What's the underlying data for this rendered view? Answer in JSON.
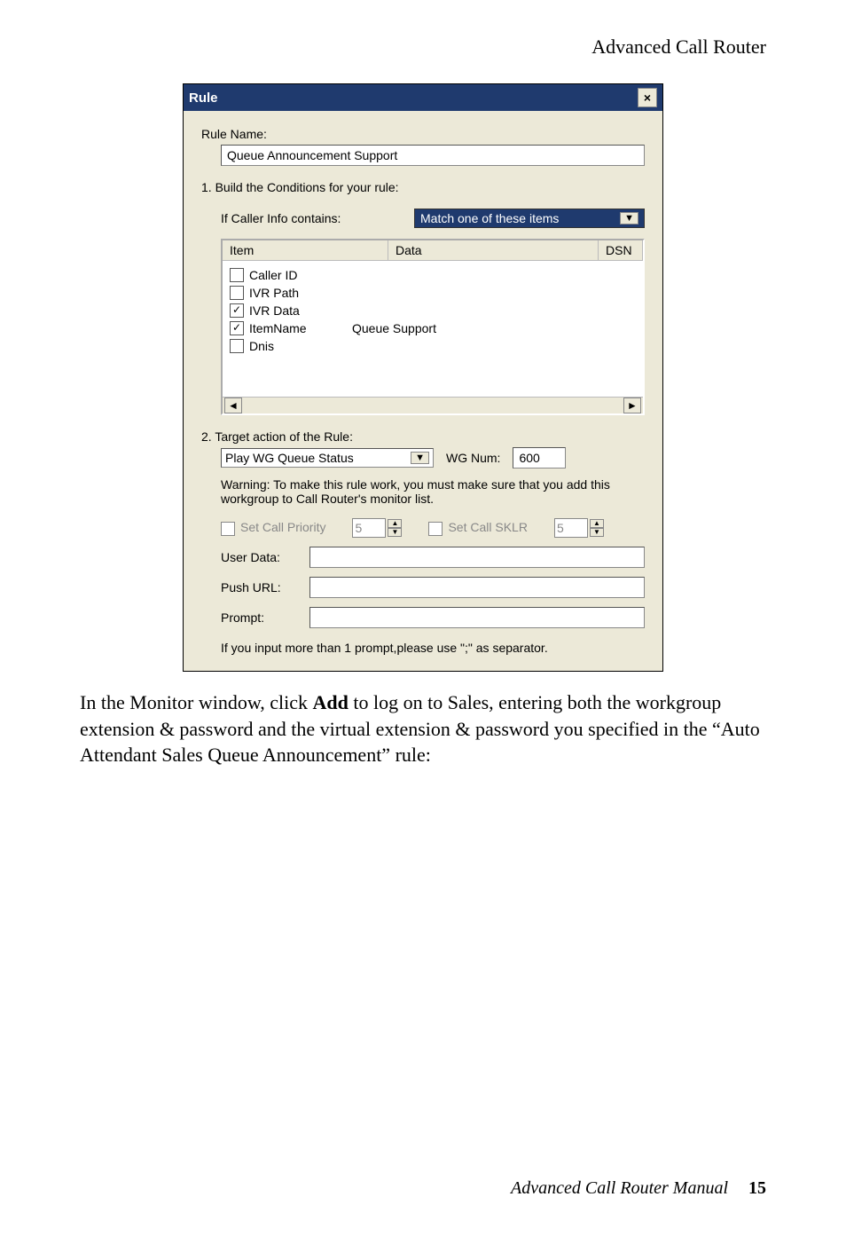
{
  "header": "Advanced Call Router",
  "dialog": {
    "title": "Rule",
    "ruleNameLabel": "Rule Name:",
    "ruleNameValue": "Queue Announcement Support",
    "buildCond": "1. Build the Conditions for your rule:",
    "callerInfoLabel": "If Caller Info contains:",
    "matchSelect": "Match one of these items",
    "lvHead": {
      "c1": "Item",
      "c2": "Data",
      "c3": "DSN"
    },
    "items": [
      {
        "checked": false,
        "name": "Caller ID",
        "data": ""
      },
      {
        "checked": false,
        "name": "IVR Path",
        "data": ""
      },
      {
        "checked": true,
        "name": "IVR Data",
        "data": ""
      },
      {
        "checked": true,
        "name": "ItemName",
        "data": "Queue Support"
      },
      {
        "checked": false,
        "name": "Dnis",
        "data": ""
      }
    ],
    "targetLabel": "2. Target action of the Rule:",
    "targetCombo": "Play WG Queue Status",
    "wgLabel": "WG Num:",
    "wgValue": "600",
    "warning": "Warning: To make this rule work, you must make sure that you add this workgroup to Call Router's monitor list.",
    "priorityLabel": "Set Call Priority",
    "priorityVal": "5",
    "sklrLabel": "Set Call SKLR",
    "sklrVal": "5",
    "userData": "User Data:",
    "pushUrl": "Push URL:",
    "prompt": "Prompt:",
    "sepNote": "If you input more than 1 prompt,please use \";\" as separator."
  },
  "paragraph": "In the Monitor window, click Add to log on to Sales, entering both the workgroup extension & password and the virtual extension & password you specified in the “Auto Attendant Sales Queue Announcement” rule:",
  "para_pre": "In the Monitor window, click ",
  "para_bold": "Add",
  "para_post": " to log on to Sales, entering both the workgroup extension & password and the virtual extension & password you specified in the “Auto Attendant Sales Queue Announcement” rule:",
  "footerTitle": "Advanced Call Router Manual",
  "pageNum": "15"
}
